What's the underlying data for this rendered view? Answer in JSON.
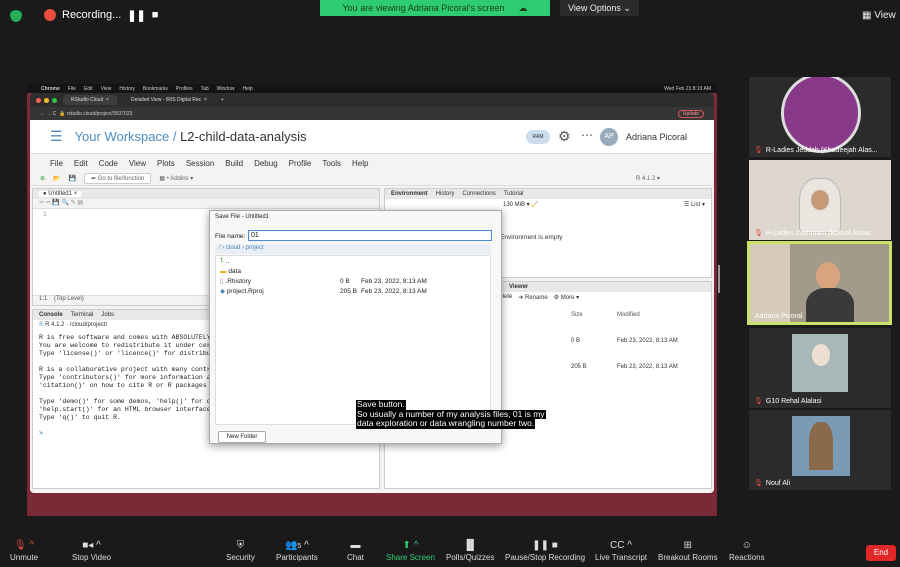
{
  "zoom_top": {
    "recording_label": "Recording...",
    "banner_text": "You are viewing Adriana Picoral's screen",
    "view_options": "View Options",
    "view_label": "View"
  },
  "chrome": {
    "mac_menu": [
      "Chrome",
      "File",
      "Edit",
      "View",
      "History",
      "Bookmarks",
      "Profiles",
      "Tab",
      "Window",
      "Help"
    ],
    "mac_clock": "Wed Feb 23 8:19 AM",
    "tabs": [
      "RStudio Cloud",
      "Detailed View - IRIS Digital Rec"
    ],
    "url": "rstudio.cloud/project/3637023",
    "update_label": "Update"
  },
  "rstudio": {
    "workspace": "Your Workspace /",
    "project_name": "L2-child-data-analysis",
    "ram_label": "RAM",
    "user_initials": "AP",
    "user_name": "Adriana Picoral",
    "menu": [
      "File",
      "Edit",
      "Code",
      "View",
      "Plots",
      "Session",
      "Build",
      "Debug",
      "Profile",
      "Tools",
      "Help"
    ],
    "goto_placeholder": "Go to file/function",
    "addins": "Addins",
    "r_version": "R 4.1.2",
    "editor_tab": "Untitled1",
    "line_number": "1",
    "status_left": "1:1",
    "status_scope": "(Top Level)",
    "env_tabs": [
      "Environment",
      "History",
      "Connections",
      "Tutorial"
    ],
    "memory": "130 MiB",
    "list_label": "List",
    "env_empty": "Environment is empty",
    "viewer_tabs": [
      "Viewer"
    ],
    "files_actions": [
      "Delete",
      "Rename",
      "More"
    ],
    "files_headers": [
      "Size",
      "Modified"
    ],
    "files_rows": [
      {
        "size": "0 B",
        "modified": "Feb 23, 2022, 8:13 AM"
      },
      {
        "size": "205 B",
        "modified": "Feb 23, 2022, 8:13 AM"
      }
    ],
    "console_tabs": [
      "Console",
      "Terminal",
      "Jobs"
    ],
    "console_path": "R 4.1.2 · /cloud/project/",
    "console_lines": [
      "R is free software and comes with ABSOLUTELY",
      "You are welcome to redistribute it under cer",
      "Type 'license()' or 'licence()' for distribu",
      "",
      "R is a collaborative project with many contr",
      "Type 'contributors()' for more information a",
      "'citation()' on how to cite R or R packages",
      "",
      "Type 'demo()' for some demos, 'help()' for o",
      "'help.start()' for an HTML browser interface to help.",
      "Type 'q()' to quit R.",
      "",
      ">"
    ]
  },
  "dialog": {
    "title": "Save File - Untitled1",
    "file_name_label": "File name:",
    "file_name_value": "01",
    "breadcrumb": "/ › cloud › project",
    "files": [
      {
        "name": "..",
        "size": "",
        "date": ""
      },
      {
        "name": "data",
        "size": "",
        "date": ""
      },
      {
        "name": ".Rhistory",
        "size": "0 B",
        "date": "Feb 23, 2022, 8:13 AM"
      },
      {
        "name": "project.Rproj",
        "size": "205 B",
        "date": "Feb 23, 2022, 8:13 AM"
      }
    ],
    "new_folder": "New Folder"
  },
  "caption_lines": [
    "Save button.",
    "So usually a number of my analysis files, 01 is my",
    "data exploration or data wrangling number two."
  ],
  "participants": [
    {
      "name": "R-Ladies Jeddah (Khadeejah Alas...",
      "muted": true
    },
    {
      "name": "R-Ladies Dammam (Batool Almar...",
      "muted": true
    },
    {
      "name": "Adriana Picoral",
      "muted": false,
      "active": true
    },
    {
      "name": "G10 Rehal Alalasi",
      "muted": true
    },
    {
      "name": "Nouf Ali",
      "muted": true
    }
  ],
  "controls": {
    "unmute": "Unmute",
    "stop_video": "Stop Video",
    "security": "Security",
    "participants": "Participants",
    "participants_count": "5",
    "chat": "Chat",
    "share_screen": "Share Screen",
    "polls": "Polls/Quizzes",
    "pause_recording": "Pause/Stop Recording",
    "live_transcript": "Live Transcript",
    "breakout_rooms": "Breakout Rooms",
    "reactions": "Reactions",
    "end": "End"
  },
  "colors": {
    "accent": "#4b8bbe",
    "share_green": "#2ecc71",
    "end_red": "#e02828",
    "active_border": "#c8e26a"
  }
}
